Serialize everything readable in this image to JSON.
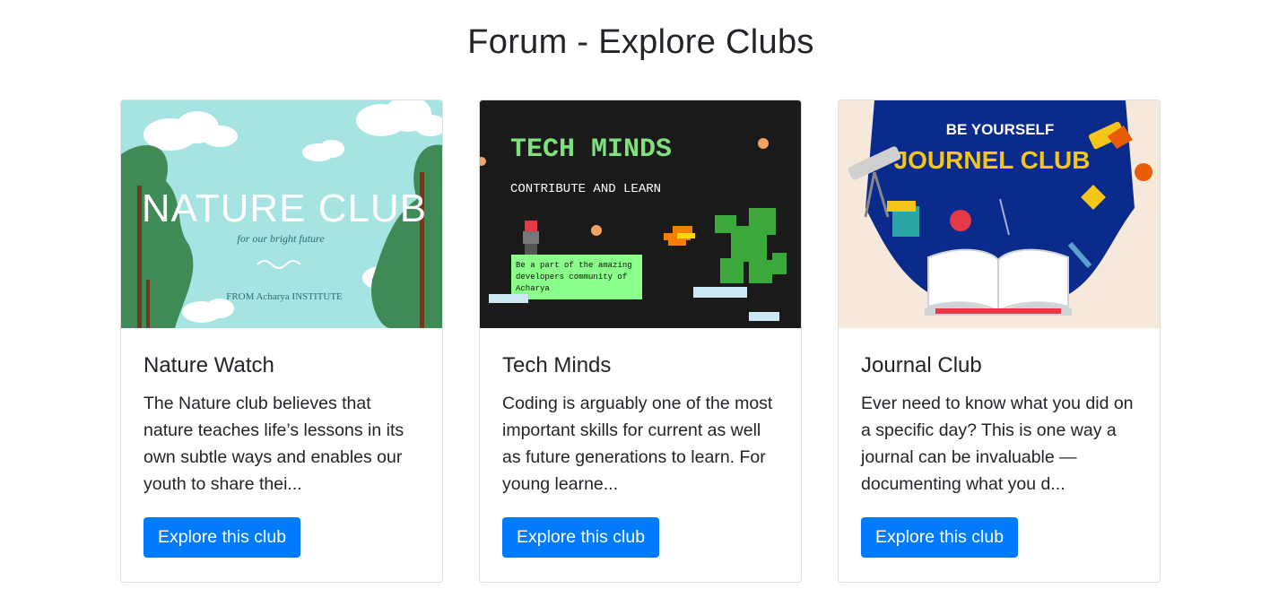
{
  "page": {
    "title": "Forum - Explore Clubs"
  },
  "clubs": [
    {
      "title": "Nature Watch",
      "description": "The Nature club believes that nature teaches life’s lessons in its own subtle ways and enables our youth to share thei...",
      "button_label": "Explore this club",
      "image": {
        "heading": "NATURE CLUB",
        "subheading": "for our bright future",
        "footer": "FROM Acharya INSTITUTE",
        "bg_color": "#a6e3e3"
      }
    },
    {
      "title": "Tech Minds",
      "description": "Coding is arguably one of the most important skills for current as well as future generations to learn. For young learne...",
      "button_label": "Explore this club",
      "image": {
        "heading": "TECH MINDS",
        "subheading": "CONTRIBUTE AND LEARN",
        "box_text": "Be a part of the amazing developers community of Acharya",
        "bg_color": "#1a1a1a"
      }
    },
    {
      "title": "Journal Club",
      "description": "Ever need to know what you did on a specific day? This is one way a journal can be invaluable — documenting what you d...",
      "button_label": "Explore this club",
      "image": {
        "heading": "JOURNEL CLUB",
        "subheading": "BE YOURSELF",
        "bg_color": "#0a2a8c"
      }
    }
  ],
  "colors": {
    "primary": "#007bff",
    "text": "#212529"
  }
}
